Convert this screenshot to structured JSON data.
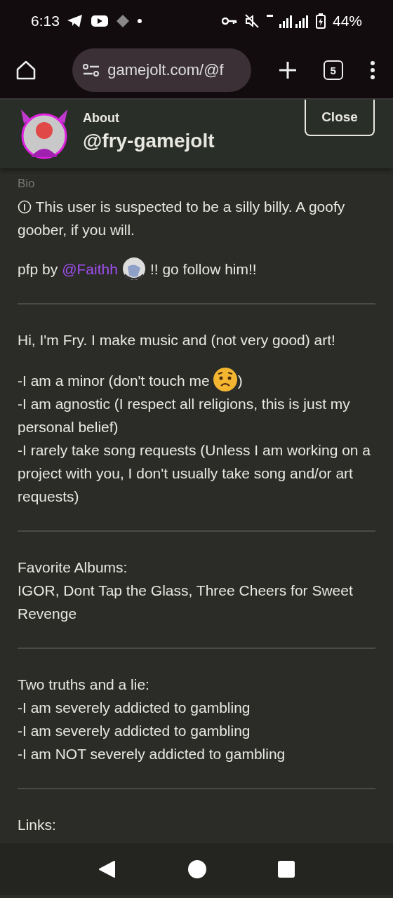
{
  "status_bar": {
    "time": "6:13",
    "battery": "44%"
  },
  "browser": {
    "url": "gamejolt.com/@f",
    "tab_count": "5"
  },
  "header": {
    "label": "About",
    "username": "@fry-gamejolt",
    "close": "Close"
  },
  "bio": {
    "label": "Bio",
    "sections": [
      {
        "paragraphs": [
          {
            "kind": "notice",
            "text": "This user is suspected to be a silly billy. A goofy goober, if you will."
          },
          {
            "kind": "credit",
            "before": "pfp by",
            "link": "@Faithh",
            "after": "!! go follow him!!"
          }
        ]
      },
      {
        "paragraphs": [
          {
            "kind": "text",
            "lines": [
              {
                "text": "Hi, I'm Fry. I make music and (not very good) art!"
              }
            ]
          },
          {
            "kind": "text",
            "lines": [
              {
                "text": "-I am a minor (don't touch me",
                "after_emoji": ")"
              },
              {
                "text": "-I am agnostic (I respect all religions, this is just my personal belief)"
              },
              {
                "text": "-I rarely take song requests (Unless I am working on a project with you, I don't usually take song and/or art requests)"
              }
            ]
          }
        ]
      },
      {
        "paragraphs": [
          {
            "kind": "text",
            "lines": [
              {
                "text": "Favorite Albums:"
              },
              {
                "text": "IGOR, Dont Tap the Glass, Three Cheers for Sweet Revenge"
              }
            ]
          }
        ]
      },
      {
        "paragraphs": [
          {
            "kind": "text",
            "lines": [
              {
                "text": "Two truths and a lie:"
              },
              {
                "text": "-I am severely addicted to gambling"
              },
              {
                "text": "-I am severely addicted to gambling"
              },
              {
                "text": "-I am NOT severely addicted to gambling"
              }
            ]
          }
        ]
      },
      {
        "paragraphs": [
          {
            "kind": "text",
            "lines": [
              {
                "text": "Links:"
              }
            ]
          }
        ]
      }
    ]
  }
}
